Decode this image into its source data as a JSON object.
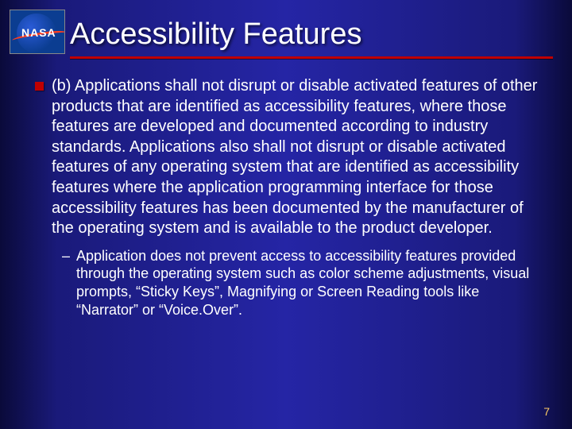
{
  "logo": {
    "text": "NASA"
  },
  "title": "Accessibility Features",
  "bullets": [
    {
      "text": "(b) Applications shall not disrupt or disable activated features of other products that are identified as accessibility features, where those features are developed and documented according to industry standards. Applications also shall not disrupt or disable activated features of any operating system that are identified as accessibility features where the application programming interface for those accessibility features has been documented by the manufacturer of the operating system and is available to the product developer.",
      "sub": [
        "Application does not prevent access to accessibility features provided through the operating system such as color scheme adjustments, visual prompts, “Sticky Keys”, Magnifying or Screen Reading tools like “Narrator” or “Voice.Over”."
      ]
    }
  ],
  "page_number": "7"
}
